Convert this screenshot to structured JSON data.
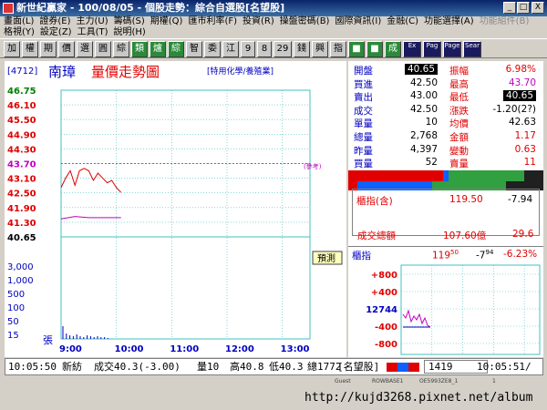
{
  "window": {
    "title": "新世紀贏家 - 100/08/05 - 個股走勢：綜合自選股[名望股]",
    "min_label": "_",
    "max_label": "□",
    "close_label": "X"
  },
  "menu": {
    "row1": [
      "畫面(L)",
      "證券(E)",
      "主力(U)",
      "籌碼(S)",
      "期權(Q)",
      "匯市利率(F)",
      "投資(R)",
      "操盤密碼(B)",
      "國際資訊(I)",
      "金融(C)",
      "功能選擇(A)",
      "功能組件(B)"
    ],
    "row1_disabled": [
      false,
      false,
      false,
      false,
      false,
      false,
      false,
      false,
      false,
      false,
      false,
      true
    ],
    "row2": [
      "格視(Y)",
      "設定(Z)",
      "工具(T)",
      "說明(H)"
    ]
  },
  "toolbar": {
    "buttons": [
      "加",
      "權",
      "期",
      "價",
      "選",
      "圓",
      "綜",
      "類",
      "爐",
      "綜",
      "智",
      "委",
      "江",
      "9",
      "8",
      "29",
      "錢",
      "興",
      "指",
      "■",
      "■",
      "成",
      "Ex",
      "Pag",
      "Page",
      "Sear"
    ]
  },
  "chart": {
    "code": "[4712]",
    "name": "南璋",
    "title": "量價走勢圖",
    "industry": "[特用化學/養殖業]",
    "price_ticks": [
      "46.75",
      "46.10",
      "45.50",
      "44.90",
      "44.30",
      "43.70",
      "43.10",
      "42.50",
      "41.90",
      "41.30",
      "40.65"
    ],
    "price_tick_colors": [
      "#008000",
      "#e00000",
      "#e00000",
      "#e00000",
      "#e00000",
      "#c000c0",
      "#e00000",
      "#e00000",
      "#e00000",
      "#e00000",
      "#000000"
    ],
    "ref_label": "(參考)",
    "volume_ticks": [
      "3,000",
      "1,000",
      "500",
      "100",
      "50",
      "15"
    ],
    "volume_unit": "張",
    "time_ticks": [
      "9:00",
      "10:00",
      "11:00",
      "12:00",
      "13:00"
    ],
    "predict_label": "預測"
  },
  "chart_data": {
    "type": "line",
    "ylim": [
      40.65,
      46.75
    ],
    "x_range": [
      "9:00",
      "13:30"
    ],
    "series": [
      {
        "color": "#e00000",
        "x": [
          "9:00",
          "9:05",
          "9:10",
          "9:15",
          "9:20",
          "9:25",
          "9:30",
          "9:35",
          "9:40",
          "9:45",
          "9:50",
          "9:55",
          "10:00",
          "10:05"
        ],
        "values": [
          42.7,
          43.1,
          43.4,
          42.8,
          43.4,
          43.5,
          43.4,
          43.0,
          43.3,
          43.1,
          42.9,
          43.0,
          42.7,
          42.5
        ]
      },
      {
        "color": "#c000c0",
        "x": [
          "9:00",
          "9:15",
          "9:30",
          "9:45",
          "10:00",
          "10:05"
        ],
        "values": [
          41.4,
          41.5,
          41.45,
          41.45,
          41.45,
          41.45
        ]
      }
    ]
  },
  "quote": {
    "rows": [
      {
        "l1": "開盤",
        "v1": "40.65",
        "v1_boxed": true,
        "l2": "振幅",
        "v2": "6.98%",
        "v2c": "red"
      },
      {
        "l1": "買進",
        "v1": "42.50",
        "l2": "最高",
        "v2": "43.70",
        "v2c": "mag"
      },
      {
        "l1": "賣出",
        "v1": "43.00",
        "l2": "最低",
        "v2": "40.65",
        "v2_boxed": true
      },
      {
        "l1": "成交",
        "v1": "42.50",
        "l2": "漲跌",
        "v2": "-1.20(2?)",
        "v2c": "blk"
      },
      {
        "l1": "單量",
        "v1": "10",
        "l2": "均價",
        "v2": "42.63",
        "v2c": "blk"
      },
      {
        "l1": "總量",
        "v1": "2,768",
        "l2": "金額",
        "v2": "1.17",
        "v2c": "red"
      },
      {
        "l1": "昨量",
        "v1": "4,397",
        "l2": "變動",
        "v2": "0.63",
        "v2c": "red"
      },
      {
        "l1": "買量",
        "v1": "52",
        "l2": "賣量",
        "v2": "11",
        "v2c": "red"
      }
    ],
    "index_label": "櫃指(含)",
    "index_value": "119.50",
    "index_change": "-7.94",
    "turnover_label": "成交總額",
    "turnover_value": "107.60億",
    "turnover_change": "29.6"
  },
  "mini": {
    "label": "櫃指",
    "value": "119",
    "value_small": "50",
    "change": "-7",
    "change_small": "94",
    "pct": "-6.23%",
    "ticks": [
      "+800",
      "+400",
      "12744",
      "-400",
      "-800"
    ]
  },
  "status": {
    "time": "10:05:50",
    "stock": "新紡",
    "deal": "成交40.3(-3.00)",
    "vol": "量10",
    "high": "高40.8",
    "low": "低40.3",
    "total": "總1772",
    "group": "[名望股]",
    "seq": "1419",
    "clock": "10:05:51/"
  },
  "lower": {
    "guest": "Guest",
    "server1": "ROWBASE1",
    "server2": "OE5993ZE8_1",
    "page_no": "1",
    "watermark": "http://kujd3268.pixnet.net/album"
  },
  "colors": {
    "titlebar": "#0a246a",
    "up": "#e00000",
    "down": "#008000",
    "avg": "#c000c0",
    "grid": "#40c0c0"
  }
}
